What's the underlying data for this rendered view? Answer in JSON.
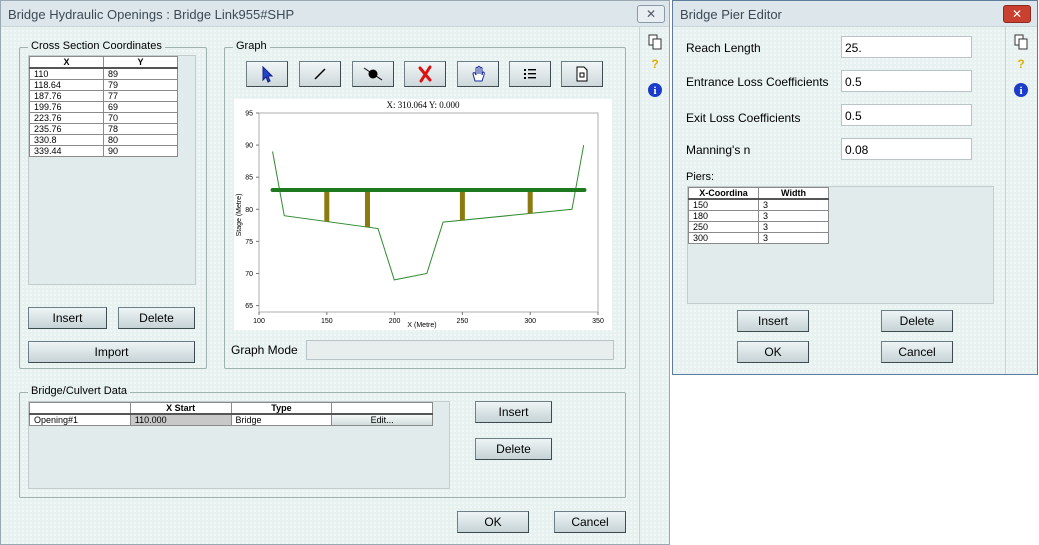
{
  "main": {
    "title": "Bridge Hydraulic Openings : Bridge Link955#SHP",
    "close_glyph": "✕",
    "cross_section": {
      "label": "Cross Section Coordinates",
      "columns": [
        "X",
        "Y"
      ],
      "rows": [
        [
          "110",
          "89"
        ],
        [
          "118.64",
          "79"
        ],
        [
          "187.76",
          "77"
        ],
        [
          "199.76",
          "69"
        ],
        [
          "223.76",
          "70"
        ],
        [
          "235.76",
          "78"
        ],
        [
          "330.8",
          "80"
        ],
        [
          "339.44",
          "90"
        ]
      ],
      "insert_label": "Insert",
      "delete_label": "Delete",
      "import_label": "Import"
    },
    "graph": {
      "label": "Graph",
      "tools": [
        "pointer-icon",
        "line-icon",
        "point-icon",
        "delete-x-icon",
        "hand-icon",
        "list-icon",
        "page-icon"
      ],
      "mode_label": "Graph Mode",
      "mode_value": ""
    },
    "bridge_data": {
      "label": "Bridge/Culvert Data",
      "columns": [
        "",
        "X Start",
        "Type",
        ""
      ],
      "rows": [
        [
          "Opening#1",
          "110.000",
          "Bridge",
          "Edit..."
        ]
      ],
      "insert_label": "Insert",
      "delete_label": "Delete"
    },
    "ok_label": "OK",
    "cancel_label": "Cancel"
  },
  "pier_editor": {
    "title": "Bridge Pier Editor",
    "close_glyph": "✕",
    "fields": [
      {
        "label": "Reach Length",
        "value": "25."
      },
      {
        "label": "Entrance Loss Coefficients",
        "value": "0.5"
      },
      {
        "label": "Exit Loss Coefficients",
        "value": "0.5"
      },
      {
        "label": "Manning's n",
        "value": "0.08"
      }
    ],
    "piers_label": "Piers:",
    "columns": [
      "X-Coordina",
      "Width"
    ],
    "rows": [
      [
        "150",
        "3"
      ],
      [
        "180",
        "3"
      ],
      [
        "250",
        "3"
      ],
      [
        "300",
        "3"
      ]
    ],
    "insert_label": "Insert",
    "delete_label": "Delete",
    "ok_label": "OK",
    "cancel_label": "Cancel"
  },
  "side_icons": [
    "copy-icon",
    "help-question-icon",
    "info-icon"
  ],
  "chart_data": {
    "type": "line",
    "readout": "X: 310.064 Y: 0.000",
    "xlabel": "X (Metre)",
    "ylabel": "Stage (Metre)",
    "xlim": [
      100,
      350
    ],
    "ylim": [
      64,
      95
    ],
    "xticks": [
      100,
      150,
      200,
      250,
      300,
      350
    ],
    "yticks": [
      65,
      70,
      75,
      80,
      85,
      90,
      95
    ],
    "ground": {
      "x": [
        110,
        118.64,
        187.76,
        199.76,
        223.76,
        235.76,
        330.8,
        339.44
      ],
      "y": [
        89,
        79,
        77,
        69,
        70,
        78,
        80,
        90
      ],
      "color": "#2f8a2f"
    },
    "deck": {
      "x": [
        110,
        340
      ],
      "y": 83,
      "color": "#1f7a1f"
    },
    "piers": {
      "x": [
        150,
        180,
        250,
        300
      ],
      "width": 3,
      "top": 83,
      "color": "#8a7a10"
    }
  }
}
